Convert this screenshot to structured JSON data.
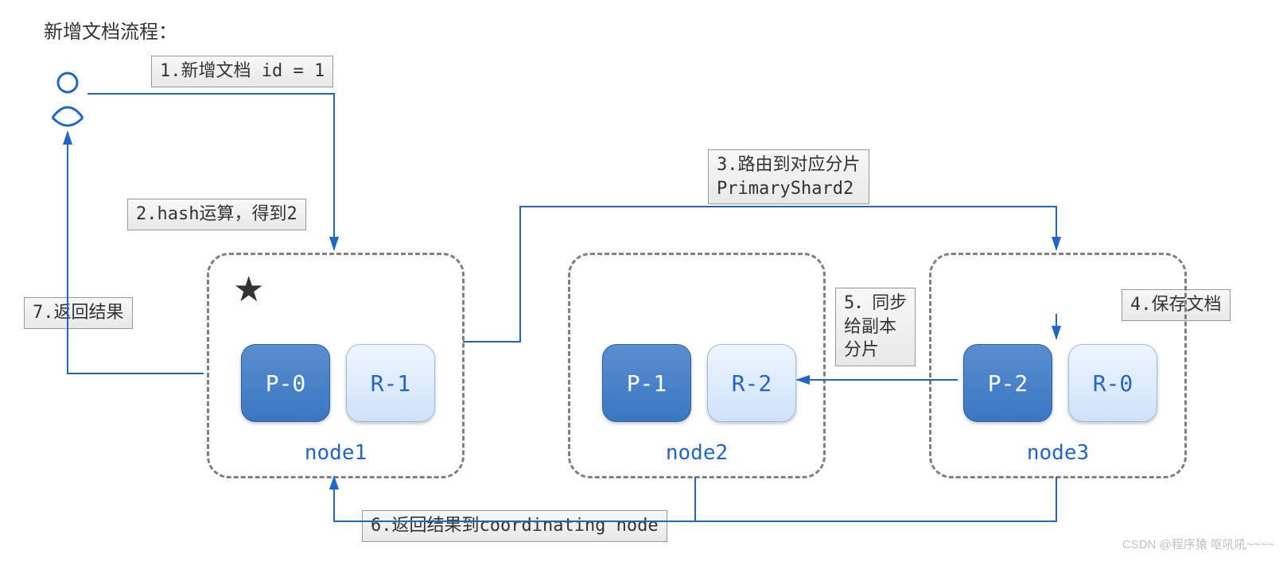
{
  "title": "新增文档流程：",
  "steps": {
    "s1": "1.新增文档 id = 1",
    "s2": "2.hash运算，得到2",
    "s3": "3.路由到对应分片\nPrimaryShard2",
    "s4": "4.保存文档",
    "s5": "5．同步\n给副本\n分片",
    "s6": "6.返回结果到coordinating node",
    "s7": "7.返回结果"
  },
  "nodes": {
    "n1": {
      "label": "node1",
      "primary": "P-0",
      "replica": "R-1"
    },
    "n2": {
      "label": "node2",
      "primary": "P-1",
      "replica": "R-2"
    },
    "n3": {
      "label": "node3",
      "primary": "P-2",
      "replica": "R-0"
    }
  },
  "watermark": "CSDN @程序猿 呕吼吼~~~~"
}
